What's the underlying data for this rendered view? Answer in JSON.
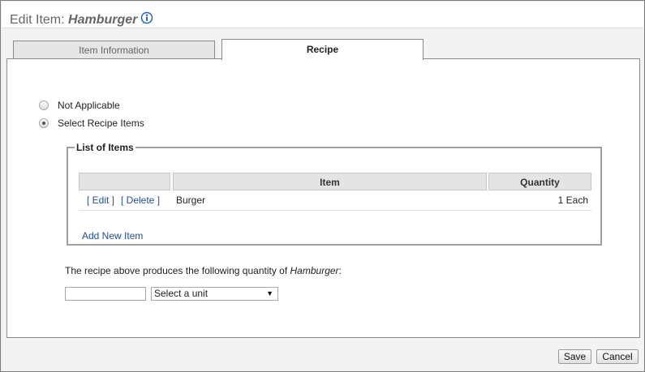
{
  "header": {
    "title_prefix": "Edit Item: ",
    "item_name": "Hamburger",
    "info_icon": "info-icon"
  },
  "tabs": [
    {
      "label": "Item Information",
      "active": false
    },
    {
      "label": "Recipe",
      "active": true
    }
  ],
  "recipe": {
    "options": [
      {
        "label": "Not Applicable",
        "selected": false
      },
      {
        "label": "Select Recipe Items",
        "selected": true
      }
    ],
    "list": {
      "legend": "List of Items",
      "columns": [
        "",
        "Item",
        "Quantity"
      ],
      "rows": [
        {
          "edit": "[ Edit ]",
          "delete": "[ Delete ]",
          "item": "Burger",
          "quantity": "1 Each"
        }
      ],
      "add_link": "Add New Item"
    },
    "produces_text": "The recipe above produces the following quantity of ",
    "produces_item": "Hamburger",
    "produces_suffix": ":",
    "quantity_value": "",
    "unit_select": "Select a unit"
  },
  "footer": {
    "save_label": "Save",
    "cancel_label": "Cancel"
  },
  "colors": {
    "link": "#1f4e9c",
    "header_bg": "#e4e4e4",
    "info_icon": "#2b64b8"
  }
}
